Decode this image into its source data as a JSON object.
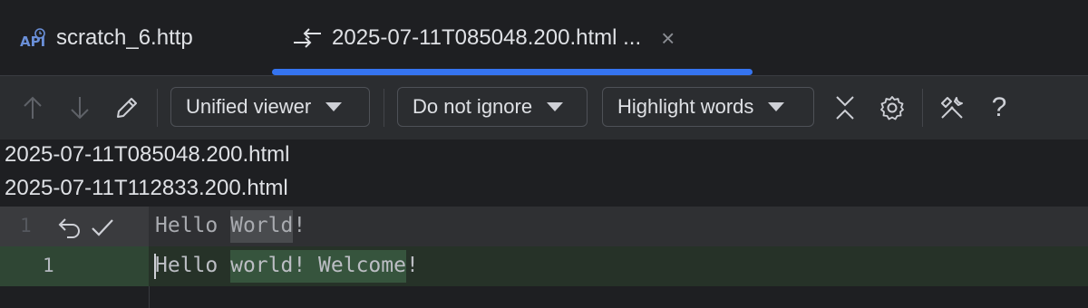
{
  "tabs": [
    {
      "label": "scratch_6.http",
      "icon": "api-icon",
      "active": false
    },
    {
      "label": "2025-07-11T085048.200.html ...",
      "icon": "diff-arrows-icon",
      "active": true,
      "close": "×"
    }
  ],
  "toolbar": {
    "viewer_mode": "Unified viewer",
    "ignore_mode": "Do not ignore",
    "highlight_mode": "Highlight words",
    "help_label": "?"
  },
  "files": {
    "left": "2025-07-11T085048.200.html",
    "right": "2025-07-11T112833.200.html"
  },
  "diff": {
    "deleted": {
      "line_number": "1",
      "before": "Hello ",
      "changed": "World",
      "after": "!"
    },
    "inserted": {
      "line_number": "1",
      "before": "Hello ",
      "changed": "world! Welcome",
      "after": "!"
    }
  },
  "colors": {
    "accent": "#3574f0",
    "inserted_bg": "#263228",
    "deleted_bg": "#2f3033"
  }
}
